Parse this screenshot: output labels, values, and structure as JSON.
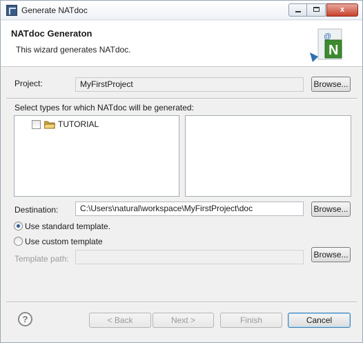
{
  "window": {
    "title": "Generate NATdoc",
    "minimize_label": "",
    "maximize_label": "",
    "close_label": "x"
  },
  "banner": {
    "title": "NATdoc Generaton",
    "description": "This wizard generates NATdoc.",
    "graphic_letters": "@ N",
    "icon": "natdoc-wizard-graphic"
  },
  "project": {
    "label": "Project:",
    "value": "MyFirstProject",
    "browse_label": "Browse..."
  },
  "types": {
    "label": "Select types for which NATdoc will be generated:",
    "items": [
      {
        "label": "TUTORIAL",
        "checked": false,
        "icon": "folder-icon"
      }
    ]
  },
  "destination": {
    "label": "Destination:",
    "value": "C:\\Users\\natural\\workspace\\MyFirstProject\\doc",
    "browse_label": "Browse..."
  },
  "template": {
    "standard_label": "Use standard template.",
    "custom_label": "Use custom template",
    "selected": "standard",
    "path_label": "Template path:",
    "path_value": "",
    "browse_label": "Browse..."
  },
  "footer": {
    "help_glyph": "?",
    "back_label": "< Back",
    "next_label": "Next >",
    "finish_label": "Finish",
    "cancel_label": "Cancel"
  },
  "colors": {
    "window_bg": "#f0f0f0",
    "banner_bg": "#ffffff",
    "close_button": "#c8432d",
    "logo_green": "#3d8a2f"
  }
}
